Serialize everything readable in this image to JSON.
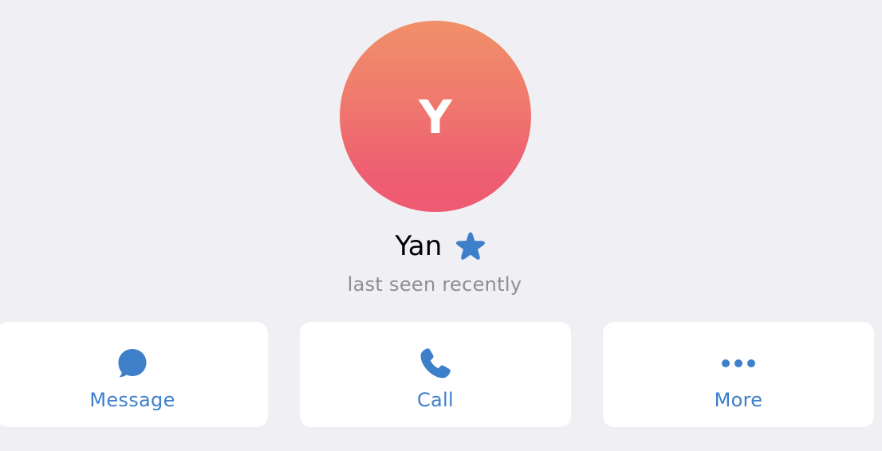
{
  "profile": {
    "initial": "Y",
    "name": "Yan",
    "status": "last seen recently",
    "badge_icon": "star-icon"
  },
  "actions": [
    {
      "label": "Message",
      "icon": "chat-bubble-icon"
    },
    {
      "label": "Call",
      "icon": "phone-icon"
    },
    {
      "label": "More",
      "icon": "more-dots-icon"
    }
  ],
  "colors": {
    "background": "#EFEFF4",
    "accent": "#3E7FCA",
    "avatar_gradient_top": "#F19069",
    "avatar_gradient_bottom": "#EE5B73",
    "status_text": "#8E8E93"
  }
}
